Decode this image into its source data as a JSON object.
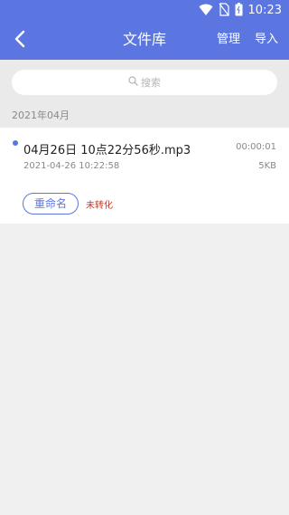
{
  "status_bar": {
    "time": "10:23",
    "icons": [
      "wifi-icon",
      "no-sim-icon",
      "battery-icon"
    ]
  },
  "app_bar": {
    "title": "文件库",
    "back_icon": "chevron-left-icon",
    "manage_label": "管理",
    "import_label": "导入",
    "background": "#5b76e0"
  },
  "search": {
    "placeholder": "搜索",
    "icon": "search-icon"
  },
  "groups": [
    {
      "header": "2021年04月",
      "files": [
        {
          "name": "04月26日 10点22分56秒.mp3",
          "duration": "00:00:01",
          "date": "2021-04-26 10:22:58",
          "size": "5KB",
          "rename_label": "重命名",
          "status": "未转化",
          "status_color": "#c0392b"
        }
      ]
    }
  ]
}
